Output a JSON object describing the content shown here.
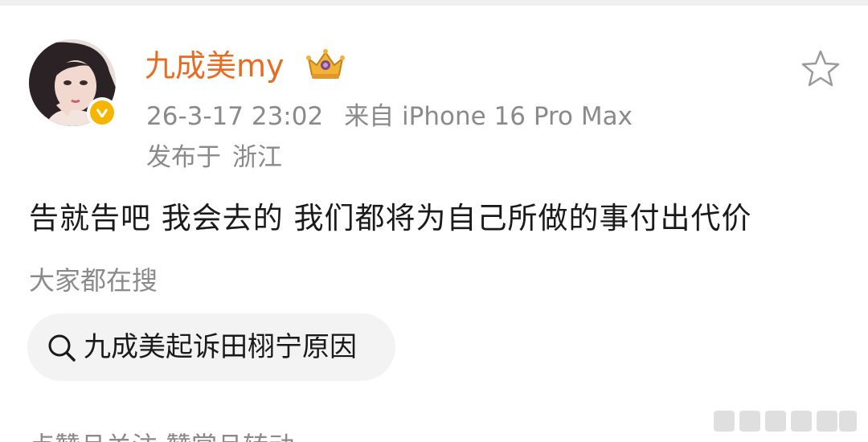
{
  "post": {
    "author": {
      "name": "九成美my",
      "avatar_icon": "user-avatar-photo",
      "verified_icon": "verified-v-icon",
      "badge_icon": "crown-badge-icon"
    },
    "timestamp": "26-3-17 23:02",
    "source": "来自 iPhone 16 Pro Max",
    "location_prefix": "发布于",
    "location": "浙江",
    "content": "告就告吧 我会去的 我们都将为自己所做的事付出代价",
    "favorite_icon": "star-outline-icon"
  },
  "search": {
    "header": "大家都在搜",
    "suggestion": "九成美起诉田栩宁原因",
    "icon": "search-icon"
  },
  "footer": {
    "partial_text": "点赞且关注    赞赏且转动"
  },
  "colors": {
    "username": "#e86b1f",
    "meta": "#8a8a8a",
    "text": "#1a1a1a",
    "verified": "#f7b500",
    "chip_bg": "#f3f3f3"
  }
}
